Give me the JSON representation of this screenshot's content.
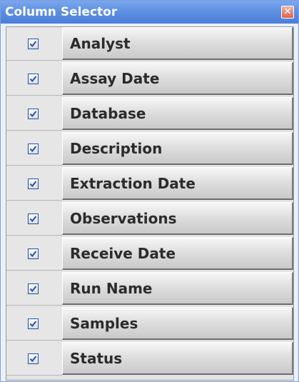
{
  "window": {
    "title": "Column Selector",
    "close_glyph": "✕",
    "close_icon": "close-icon"
  },
  "columns": [
    {
      "label": "Analyst",
      "checked": true
    },
    {
      "label": "Assay Date",
      "checked": true
    },
    {
      "label": "Database",
      "checked": true
    },
    {
      "label": "Description",
      "checked": true
    },
    {
      "label": "Extraction Date",
      "checked": true
    },
    {
      "label": "Observations",
      "checked": true
    },
    {
      "label": "Receive Date",
      "checked": true
    },
    {
      "label": "Run Name",
      "checked": true
    },
    {
      "label": "Samples",
      "checked": true
    },
    {
      "label": "Status",
      "checked": true
    }
  ],
  "colors": {
    "titlebar": "#5f90e2",
    "checkmark": "#1f4fb0"
  }
}
